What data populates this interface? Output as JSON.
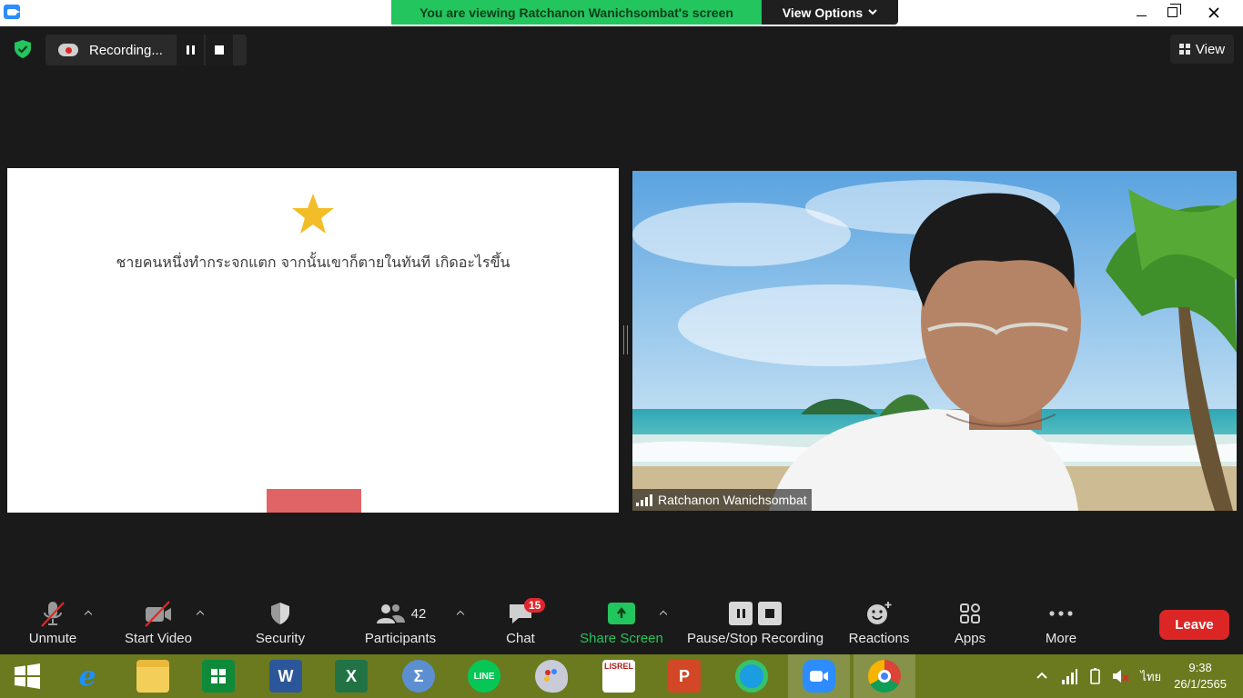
{
  "banner": {
    "viewing_text": "You are viewing Ratchanon Wanichsombat's screen",
    "view_options_label": "View Options"
  },
  "recording": {
    "label": "Recording..."
  },
  "view_button": {
    "label": "View"
  },
  "shared_content": {
    "question_text": "ชายคนหนึ่งทำกระจกแตก จากนั้นเขาก็ตายในทันที เกิดอะไรขึ้น"
  },
  "video": {
    "participant_name": "Ratchanon Wanichsombat"
  },
  "toolbar": {
    "unmute_label": "Unmute",
    "start_video_label": "Start Video",
    "security_label": "Security",
    "participants_label": "Participants",
    "participants_count": "42",
    "chat_label": "Chat",
    "chat_badge": "15",
    "share_screen_label": "Share Screen",
    "recording_label": "Pause/Stop Recording",
    "reactions_label": "Reactions",
    "apps_label": "Apps",
    "more_label": "More",
    "leave_label": "Leave"
  },
  "taskbar": {
    "apps": [
      "start",
      "internet-explorer",
      "file-explorer",
      "store",
      "word",
      "excel",
      "math-input",
      "line",
      "paint",
      "lisrel",
      "powerpoint",
      "edge",
      "zoom",
      "chrome"
    ],
    "language": "ไทย",
    "time": "9:38",
    "date": "26/1/2565"
  },
  "colors": {
    "share_green": "#22c55e",
    "leave_red": "#dc2626",
    "taskbar": "#6b7a1f",
    "badge": "#e0262d"
  }
}
